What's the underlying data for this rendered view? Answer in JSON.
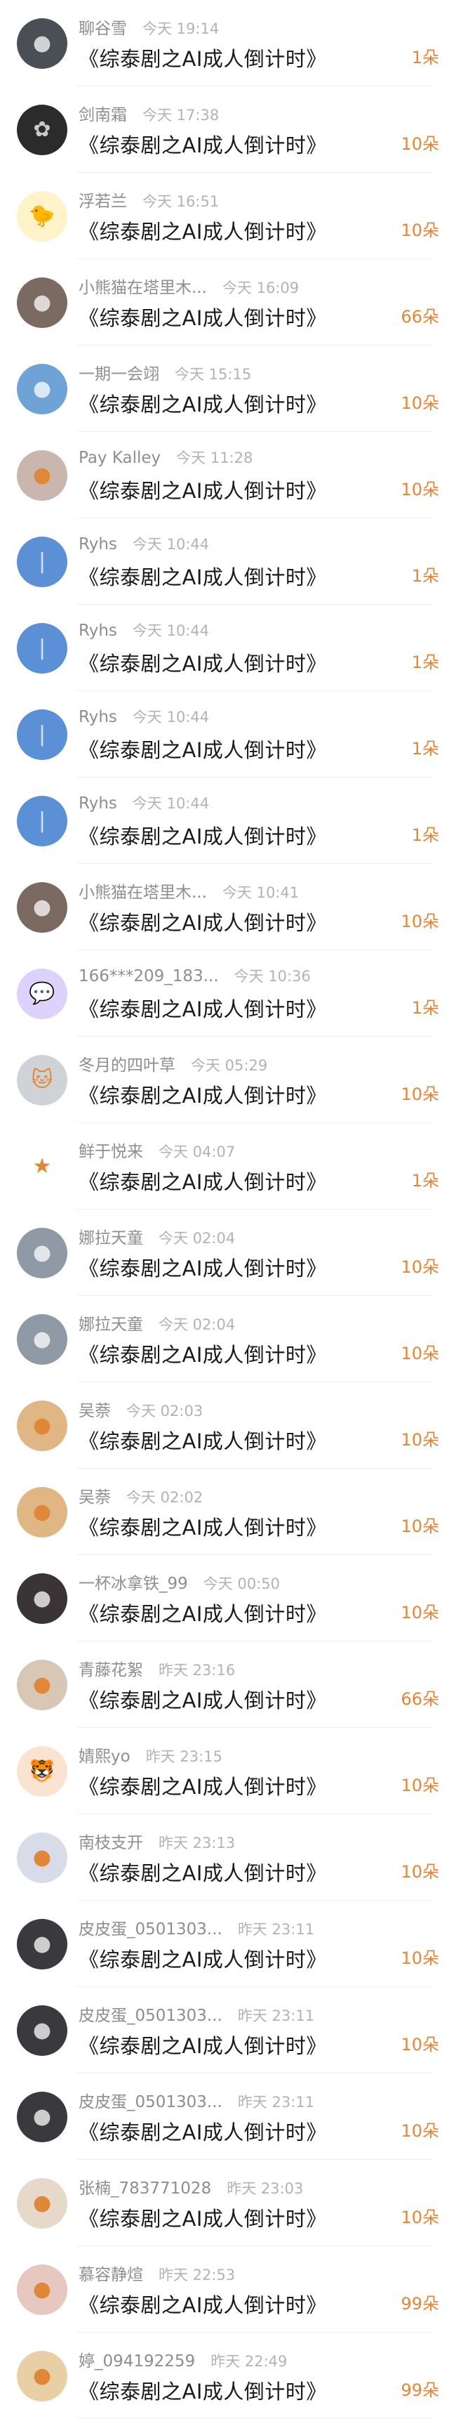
{
  "colors": {
    "count": "#e0873a",
    "name": "#8e8e8e",
    "time": "#b3b3b3",
    "title": "#1a1a1a"
  },
  "rows": [
    {
      "name": "聊谷雪",
      "time": "今天 19:14",
      "title": "《综泰剧之AI成人倒计时》",
      "count": "1朵",
      "avatar": {
        "bg": "#4a4e55",
        "icon": "●"
      }
    },
    {
      "name": "剑南霜",
      "time": "今天 17:38",
      "title": "《综泰剧之AI成人倒计时》",
      "count": "10朵",
      "avatar": {
        "bg": "#2b2b2b",
        "icon": "✿"
      }
    },
    {
      "name": "浮若兰",
      "time": "今天 16:51",
      "title": "《综泰剧之AI成人倒计时》",
      "count": "10朵",
      "avatar": {
        "bg": "#fff3c9",
        "icon": "🐤"
      }
    },
    {
      "name": "小熊猫在塔里木...",
      "time": "今天 16:09",
      "title": "《综泰剧之AI成人倒计时》",
      "count": "66朵",
      "avatar": {
        "bg": "#7b6a62",
        "icon": "●"
      }
    },
    {
      "name": "一期一会翊",
      "time": "今天 15:15",
      "title": "《综泰剧之AI成人倒计时》",
      "count": "10朵",
      "avatar": {
        "bg": "#6fa3d8",
        "icon": "●"
      }
    },
    {
      "name": "Pay Kalley",
      "time": "今天 11:28",
      "title": "《综泰剧之AI成人倒计时》",
      "count": "10朵",
      "avatar": {
        "bg": "#c9b7ad",
        "icon": "●"
      }
    },
    {
      "name": "Ryhs",
      "time": "今天 10:44",
      "title": "《综泰剧之AI成人倒计时》",
      "count": "1朵",
      "avatar": {
        "bg": "#5b8fd6",
        "icon": "|"
      }
    },
    {
      "name": "Ryhs",
      "time": "今天 10:44",
      "title": "《综泰剧之AI成人倒计时》",
      "count": "1朵",
      "avatar": {
        "bg": "#5b8fd6",
        "icon": "|"
      }
    },
    {
      "name": "Ryhs",
      "time": "今天 10:44",
      "title": "《综泰剧之AI成人倒计时》",
      "count": "1朵",
      "avatar": {
        "bg": "#5b8fd6",
        "icon": "|"
      }
    },
    {
      "name": "Ryhs",
      "time": "今天 10:44",
      "title": "《综泰剧之AI成人倒计时》",
      "count": "1朵",
      "avatar": {
        "bg": "#5b8fd6",
        "icon": "|"
      }
    },
    {
      "name": "小熊猫在塔里木...",
      "time": "今天 10:41",
      "title": "《综泰剧之AI成人倒计时》",
      "count": "10朵",
      "avatar": {
        "bg": "#7b6a62",
        "icon": "●"
      }
    },
    {
      "name": "166***209_183...",
      "time": "今天 10:36",
      "title": "《综泰剧之AI成人倒计时》",
      "count": "1朵",
      "avatar": {
        "bg": "#ddd2fb",
        "icon": "💬"
      }
    },
    {
      "name": "冬月的四叶草",
      "time": "今天 05:29",
      "title": "《综泰剧之AI成人倒计时》",
      "count": "10朵",
      "avatar": {
        "bg": "#cfd2d6",
        "icon": "🐱"
      }
    },
    {
      "name": "鲜于悦来",
      "time": "今天 04:07",
      "title": "《综泰剧之AI成人倒计时》",
      "count": "1朵",
      "avatar": {
        "bg": "#ffffff",
        "icon": "★"
      }
    },
    {
      "name": "娜拉天童",
      "time": "今天 02:04",
      "title": "《综泰剧之AI成人倒计时》",
      "count": "10朵",
      "avatar": {
        "bg": "#8f9aa6",
        "icon": "●"
      }
    },
    {
      "name": "娜拉天童",
      "time": "今天 02:04",
      "title": "《综泰剧之AI成人倒计时》",
      "count": "10朵",
      "avatar": {
        "bg": "#8f9aa6",
        "icon": "●"
      }
    },
    {
      "name": "吴萘",
      "time": "今天 02:03",
      "title": "《综泰剧之AI成人倒计时》",
      "count": "10朵",
      "avatar": {
        "bg": "#e0b784",
        "icon": "●"
      }
    },
    {
      "name": "吴萘",
      "time": "今天 02:02",
      "title": "《综泰剧之AI成人倒计时》",
      "count": "10朵",
      "avatar": {
        "bg": "#e0b784",
        "icon": "●"
      }
    },
    {
      "name": "一杯冰拿铁_99",
      "time": "今天 00:50",
      "title": "《综泰剧之AI成人倒计时》",
      "count": "10朵",
      "avatar": {
        "bg": "#3b3437",
        "icon": "●"
      }
    },
    {
      "name": "青藤花絮",
      "time": "昨天 23:16",
      "title": "《综泰剧之AI成人倒计时》",
      "count": "66朵",
      "avatar": {
        "bg": "#d9c7b5",
        "icon": "●"
      }
    },
    {
      "name": "婧熙yo",
      "time": "昨天 23:15",
      "title": "《综泰剧之AI成人倒计时》",
      "count": "10朵",
      "avatar": {
        "bg": "#fbe3d2",
        "icon": "🐯"
      }
    },
    {
      "name": "南枝支开",
      "time": "昨天 23:13",
      "title": "《综泰剧之AI成人倒计时》",
      "count": "10朵",
      "avatar": {
        "bg": "#d8dce8",
        "icon": "●"
      }
    },
    {
      "name": "皮皮蛋_0501303...",
      "time": "昨天 23:11",
      "title": "《综泰剧之AI成人倒计时》",
      "count": "10朵",
      "avatar": {
        "bg": "#3a3a3e",
        "icon": "●"
      }
    },
    {
      "name": "皮皮蛋_0501303...",
      "time": "昨天 23:11",
      "title": "《综泰剧之AI成人倒计时》",
      "count": "10朵",
      "avatar": {
        "bg": "#3a3a3e",
        "icon": "●"
      }
    },
    {
      "name": "皮皮蛋_0501303...",
      "time": "昨天 23:11",
      "title": "《综泰剧之AI成人倒计时》",
      "count": "10朵",
      "avatar": {
        "bg": "#3a3a3e",
        "icon": "●"
      }
    },
    {
      "name": "张楠_783771028",
      "time": "昨天 23:03",
      "title": "《综泰剧之AI成人倒计时》",
      "count": "10朵",
      "avatar": {
        "bg": "#e7d9c9",
        "icon": "●"
      }
    },
    {
      "name": "慕容静煊",
      "time": "昨天 22:53",
      "title": "《综泰剧之AI成人倒计时》",
      "count": "99朵",
      "avatar": {
        "bg": "#e6c8c1",
        "icon": "●"
      }
    },
    {
      "name": "婷_094192259",
      "time": "昨天 22:49",
      "title": "《综泰剧之AI成人倒计时》",
      "count": "99朵",
      "avatar": {
        "bg": "#e8cfa6",
        "icon": "●"
      }
    }
  ]
}
